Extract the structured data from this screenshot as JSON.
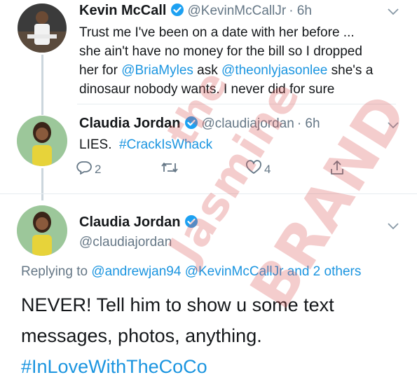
{
  "tweet1": {
    "name": "Kevin McCall",
    "handle": "@KevinMcCallJr",
    "time": "· 6h",
    "text_1": "Trust me I've been on a date with her before ...",
    "text_2": "she ain't have no money for the bill so I dropped",
    "text_3a": "her for ",
    "mention_1": "@BriaMyles",
    "text_3b": " ask ",
    "mention_2": "@theonlyjasonlee",
    "text_3c": " she's a",
    "text_4": "dinosaur nobody wants. I never did for sure"
  },
  "tweet2": {
    "name": "Claudia Jordan",
    "handle": "@claudiajordan",
    "time": "· 6h",
    "text": "LIES.",
    "hashtag": "#CrackIsWhack",
    "reply_count": "2",
    "retweet_count": "",
    "like_count": "4"
  },
  "tweet3": {
    "name": "Claudia Jordan",
    "handle": "@claudiajordan",
    "replying_prefix": "Replying to",
    "replying_1": "@andrewjan94",
    "replying_2": "@KevinMcCallJr",
    "replying_suffix": "and 2 others",
    "text_1": "NEVER! Tell him to show u some text",
    "text_2": "messages, photos, anything.",
    "hashtag": "#InLoveWithTheCoCo"
  },
  "watermark": {
    "line_1": "the",
    "line_2": "Jasmine",
    "line_3": "BRAND"
  },
  "colors": {
    "link": "#1b95e0",
    "verified": "#1da1f2",
    "secondary": "#657786"
  },
  "icons": [
    "verified-badge-icon",
    "chevron-down-icon",
    "reply-icon",
    "retweet-icon",
    "like-icon",
    "share-icon"
  ]
}
